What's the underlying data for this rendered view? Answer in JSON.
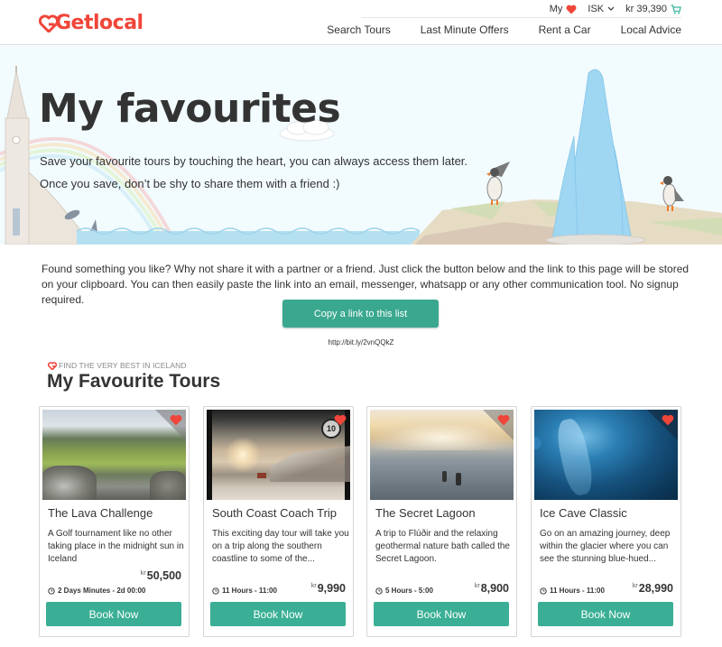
{
  "header": {
    "logo": "Getlocal",
    "topbar": {
      "my_label": "My",
      "currency": "ISK",
      "cart_total": "kr 39,390"
    },
    "nav": [
      "Search Tours",
      "Last Minute Offers",
      "Rent a Car",
      "Local Advice"
    ]
  },
  "hero": {
    "title": "My favourites",
    "line1": "Save your favourite tours by touching the heart, you can always access them later.",
    "line2": "Once you save, don’t be shy to share them with a friend :)"
  },
  "share": {
    "text": "Found something you like? Why not share it with a partner or a friend. Just click the button below and the link to this page will be stored on your clipboard. You can then easily paste the link into an email, messenger, whatsapp or any other communication tool. No signup required.",
    "button_label": "Copy a link to this list",
    "short_link": "http://bit.ly/2vnQQkZ"
  },
  "section": {
    "eyebrow": "FIND THE VERY BEST IN ICELAND",
    "title": "My Favourite Tours"
  },
  "tours": [
    {
      "name": "The Lava Challenge",
      "description": "A Golf tournament like no other taking place in the midnight sun in Iceland",
      "currency": "kr",
      "price": "50,500",
      "duration": "2 Days Minutes - 2d 00:00",
      "book_label": "Book Now",
      "favourited": true
    },
    {
      "name": "South Coast Coach Trip",
      "description": "This exciting day tour will take you on a trip along the southern coastline to some of the...",
      "currency": "kr",
      "price": "9,990",
      "duration": "11 Hours - 11:00",
      "book_label": "Book Now",
      "favourited": true,
      "badge": "10"
    },
    {
      "name": "The Secret Lagoon",
      "description": "A trip to Flúðir and the relaxing geothermal nature bath called the Secret Lagoon.",
      "currency": "kr",
      "price": "8,900",
      "duration": "5 Hours - 5:00",
      "book_label": "Book Now",
      "favourited": true
    },
    {
      "name": "Ice Cave Classic",
      "description": "Go on an amazing journey, deep within the glacier where you can see the stunning blue-hued...",
      "currency": "kr",
      "price": "28,990",
      "duration": "11 Hours - 11:00",
      "book_label": "Book Now",
      "favourited": true
    }
  ],
  "colors": {
    "brand": "#f0453a",
    "primary_button": "#3aa88f",
    "hero_bg": "#f2fbfe",
    "cart_icon": "#3ab8a0"
  }
}
